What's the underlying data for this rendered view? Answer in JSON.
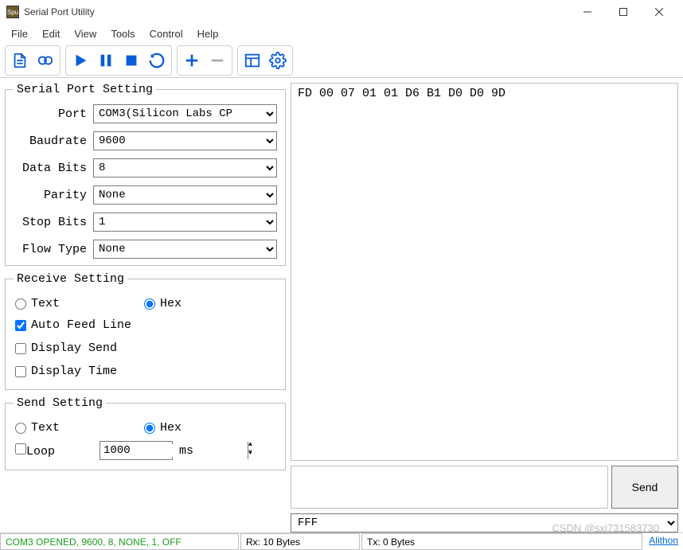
{
  "window": {
    "title": "Serial Port Utility"
  },
  "menu": {
    "file": "File",
    "edit": "Edit",
    "view": "View",
    "tools": "Tools",
    "control": "Control",
    "help": "Help"
  },
  "groups": {
    "serial": {
      "legend": "Serial Port Setting",
      "port_label": "Port",
      "port_value": "COM3(Silicon Labs CP",
      "baud_label": "Baudrate",
      "baud_value": "9600",
      "databits_label": "Data Bits",
      "databits_value": "8",
      "parity_label": "Parity",
      "parity_value": "None",
      "stopbits_label": "Stop Bits",
      "stopbits_value": "1",
      "flow_label": "Flow Type",
      "flow_value": "None"
    },
    "recv": {
      "legend": "Receive Setting",
      "text_label": "Text",
      "hex_label": "Hex",
      "auto_feed": "Auto Feed Line",
      "display_send": "Display Send",
      "display_time": "Display Time"
    },
    "send": {
      "legend": "Send Setting",
      "text_label": "Text",
      "hex_label": "Hex",
      "loop_label": "Loop",
      "loop_value": "1000",
      "loop_unit": "ms"
    }
  },
  "rx_data": "FD 00 07 01 01 D6 B1 D0 D0 9D",
  "tx": {
    "input_value": "",
    "send_button": "Send",
    "combo_value": "FFF"
  },
  "status": {
    "port_status": "COM3 OPENED, 9600, 8, NONE, 1, OFF",
    "rx": "Rx: 10 Bytes",
    "tx": "Tx: 0 Bytes",
    "link": "Alithon"
  },
  "watermark": "CSDN @sxj731583730"
}
